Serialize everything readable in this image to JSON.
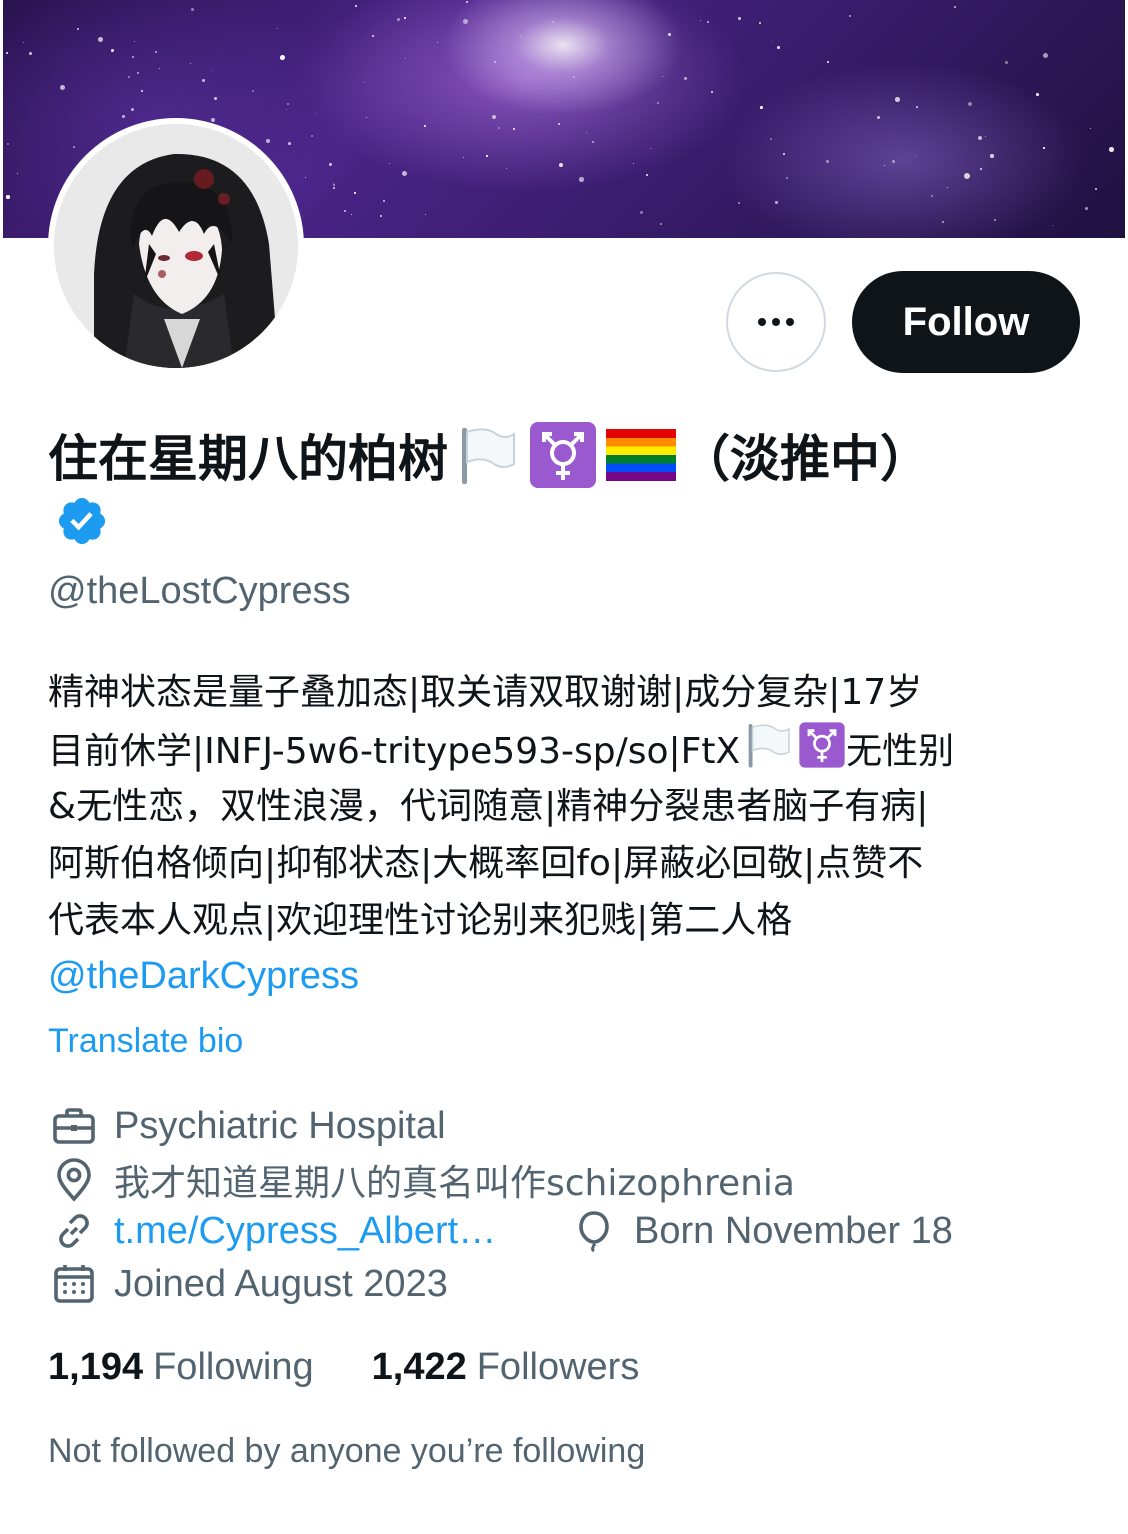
{
  "profile": {
    "display_name": "住在星期八的柏树",
    "display_name_suffix": "（淡推中）",
    "verified": true,
    "handle": "@theLostCypress",
    "follow_label": "Follow",
    "more_label": "More"
  },
  "bio": {
    "lines": [
      "精神状态是量子叠加态|取关请双取谢谢|成分复杂|17岁",
      "目前休学|INFJ-5w6-tritype593-sp/so|FtX",
      "无性别",
      "&无性恋，双性浪漫，代词随意|精神分裂患者脑子有病|",
      "阿斯伯格倾向|抑郁状态|大概率回fo|屏蔽必回敬|点赞不",
      "代表本人观点|欢迎理性讨论别来犯贱|第二人格"
    ],
    "mention": "@theDarkCypress",
    "translate_label": "Translate bio"
  },
  "meta": {
    "profession": "Psychiatric Hospital",
    "location": "我才知道星期八的真名叫作schizophrenia",
    "website": "t.me/Cypress_Albert…",
    "birthday": "Born November 18",
    "joined": "Joined August 2023"
  },
  "stats": {
    "following_count": "1,194",
    "following_label": "Following",
    "followers_count": "1,422",
    "followers_label": "Followers"
  },
  "mutuals_text": "Not followed by anyone you’re following",
  "icons": {
    "verified": "verified-badge-icon",
    "profession": "briefcase-icon",
    "location": "location-pin-icon",
    "website": "link-icon",
    "birthday": "balloon-icon",
    "joined": "calendar-icon",
    "flags": [
      "white-flag-icon",
      "transgender-symbol-icon",
      "rainbow-flag-icon"
    ]
  },
  "colors": {
    "accent": "#1d9bf0",
    "text_primary": "#0f1419",
    "text_secondary": "#536471",
    "follow_button_bg": "#0f1419",
    "border": "#cfd9de"
  }
}
